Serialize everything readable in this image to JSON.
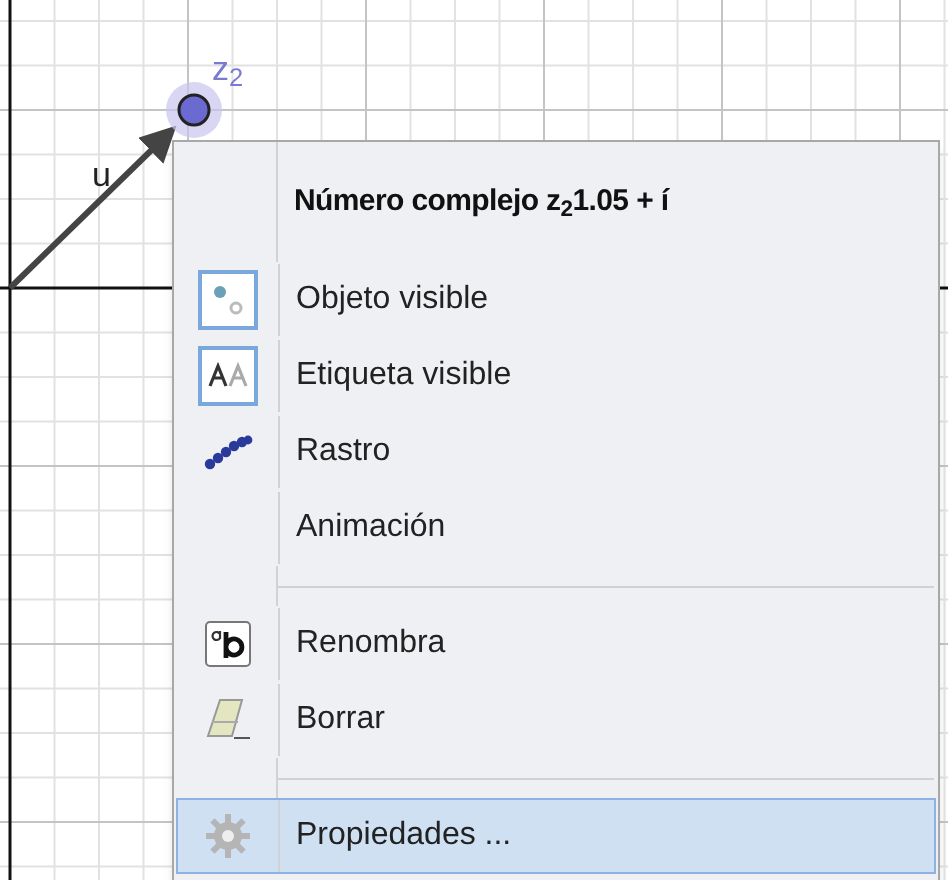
{
  "canvas": {
    "point_label": "z$_{2}$",
    "vector_label": "u"
  },
  "menu": {
    "title": "Número complejo z$_{2}$1.05 + í",
    "items": [
      {
        "kind": "show-object",
        "label": "Objeto visible",
        "checked": true,
        "selected": false
      },
      {
        "kind": "show-label",
        "label": "Etiqueta visible",
        "checked": true,
        "selected": false
      },
      {
        "kind": "trace",
        "label": "Rastro",
        "checked": false,
        "selected": false
      },
      {
        "kind": "animation",
        "label": "Animación",
        "selected": false
      },
      {
        "kind": "separator"
      },
      {
        "kind": "rename",
        "label": "Renombra",
        "selected": false
      },
      {
        "kind": "delete",
        "label": "Borrar",
        "selected": false
      },
      {
        "kind": "separator"
      },
      {
        "kind": "properties",
        "label": "Propiedades ...",
        "selected": true
      }
    ]
  }
}
